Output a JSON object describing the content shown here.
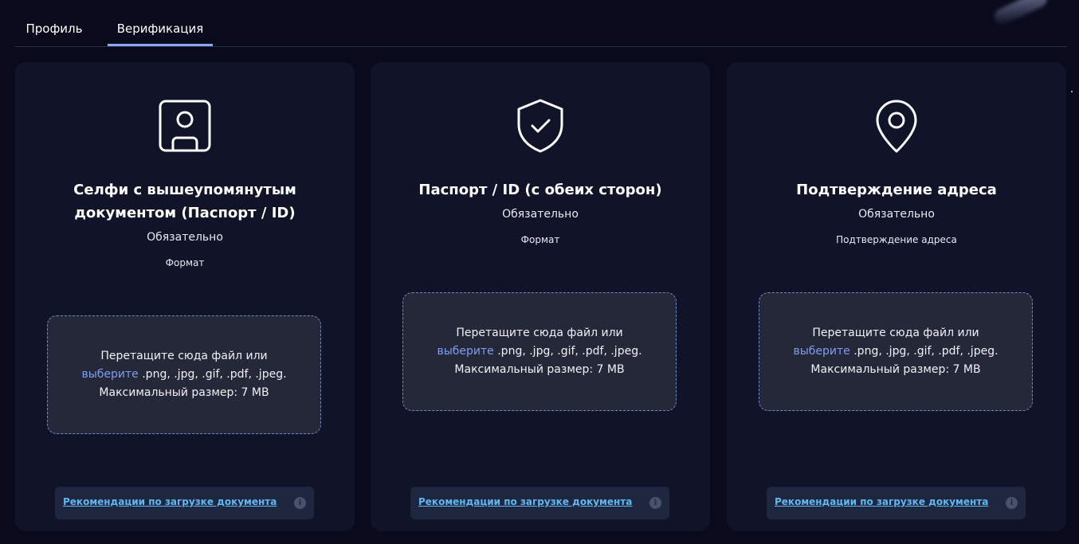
{
  "tabs": [
    {
      "label": "Профиль",
      "active": false
    },
    {
      "label": "Верификация",
      "active": true
    }
  ],
  "accent_color": "#8ba8f2",
  "link_color": "#7f9ef0",
  "cards": [
    {
      "icon": "user-portrait-icon",
      "title": "Селфи с вышеупомянутым документом (Паспорт / ID)",
      "required": "Обязательно",
      "format": "Формат",
      "drop": {
        "text_before": "Перетащите сюда файл или",
        "link": "выберите",
        "formats": ".png, .jpg, .gif, .pdf, .jpeg.",
        "max_size": "Максимальный размер: 7 MB"
      },
      "recommendations": "Рекомендации по загрузке документа",
      "info_symbol": "i"
    },
    {
      "icon": "shield-check-icon",
      "title": "Паспорт / ID (с обеих сторон)",
      "required": "Обязательно",
      "format": "Формат",
      "drop": {
        "text_before": "Перетащите сюда файл или",
        "link": "выберите",
        "formats": ".png, .jpg, .gif, .pdf, .jpeg.",
        "max_size": "Максимальный размер: 7 MB"
      },
      "recommendations": "Рекомендации по загрузке документа",
      "info_symbol": "i"
    },
    {
      "icon": "map-pin-icon",
      "title": "Подтверждение адреса",
      "required": "Обязательно",
      "format": "Подтверждение адреса",
      "drop": {
        "text_before": "Перетащите сюда файл или",
        "link": "выберите",
        "formats": ".png, .jpg, .gif, .pdf, .jpeg.",
        "max_size": "Максимальный размер: 7 MB"
      },
      "recommendations": "Рекомендации по загрузке документа",
      "info_symbol": "i"
    }
  ]
}
